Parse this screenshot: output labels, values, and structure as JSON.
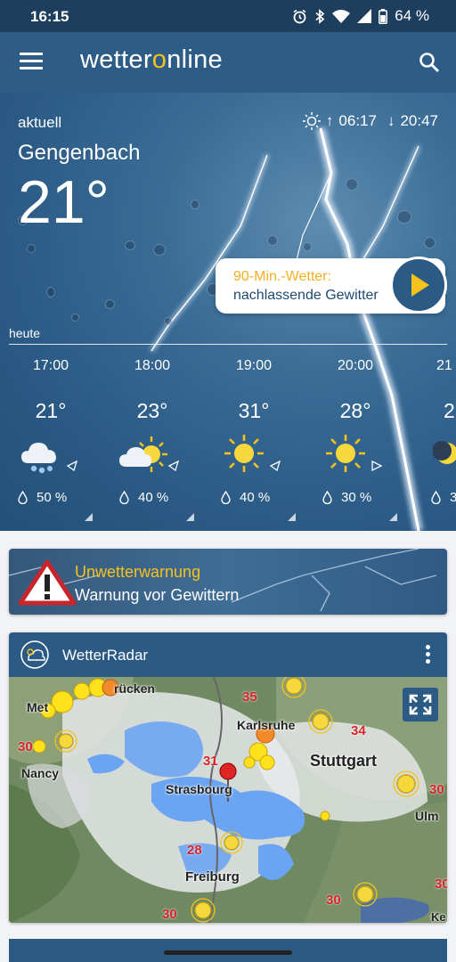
{
  "status_bar": {
    "time": "16:15",
    "battery": "64 %"
  },
  "app": {
    "logo_pre": "wetter",
    "logo_o": "o",
    "logo_post": "nline"
  },
  "current": {
    "label": "aktuell",
    "city": "Gengenbach",
    "temperature": "21°",
    "sunrise": "06:17",
    "sunset": "20:47"
  },
  "forecast_card": {
    "title": "90-Min.-Wetter:",
    "subtitle": "nachlassende Gewitter"
  },
  "hourly": {
    "label": "heute",
    "items": [
      {
        "hour": "17:00",
        "temp": "21°",
        "icon": "cloud-rain-icon",
        "rain": "50 %"
      },
      {
        "hour": "18:00",
        "temp": "23°",
        "icon": "sun-cloud-icon",
        "rain": "40 %"
      },
      {
        "hour": "19:00",
        "temp": "31°",
        "icon": "sun-icon",
        "rain": "40 %"
      },
      {
        "hour": "20:00",
        "temp": "28°",
        "icon": "sun-icon",
        "rain": "30 %"
      },
      {
        "hour": "21",
        "temp": "2",
        "icon": "moon-icon",
        "rain": "3"
      }
    ]
  },
  "warning": {
    "title": "Unwetterwarnung",
    "text": "Warnung vor Gewittern"
  },
  "radar": {
    "title": "WetterRadar",
    "places": [
      "rücken",
      "Met",
      "Nancy",
      "Karlsruhe",
      "Stuttgart",
      "Strasbourg",
      "Ulm",
      "Freiburg",
      "Ke"
    ],
    "temperatures": [
      "35",
      "34",
      "30",
      "31",
      "28",
      "30",
      "30",
      "30",
      "30"
    ]
  },
  "colors": {
    "appbar": "#2d5d87",
    "statusbar": "#1e3e5e",
    "accent": "#f6c21c"
  }
}
